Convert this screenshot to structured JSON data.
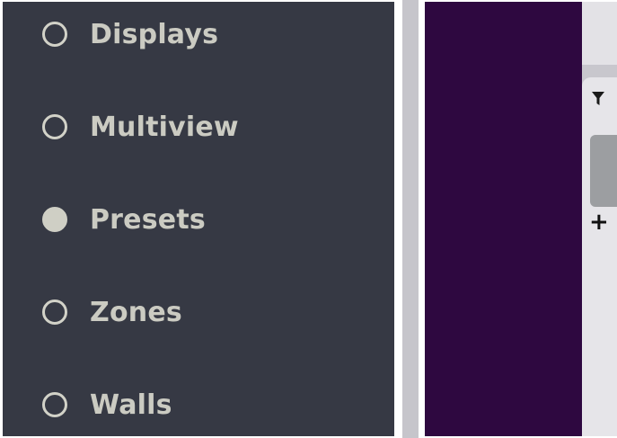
{
  "sidebar": {
    "items": [
      {
        "label": "Displays",
        "selected": false
      },
      {
        "label": "Multiview",
        "selected": false
      },
      {
        "label": "Presets",
        "selected": true
      },
      {
        "label": "Zones",
        "selected": false
      },
      {
        "label": "Walls",
        "selected": false
      }
    ]
  },
  "right_panel": {
    "add_label": "+",
    "icons": {
      "filter": "filter-icon"
    }
  },
  "colors": {
    "sidebar_bg": "#363944",
    "sidebar_text": "#cbcbc2",
    "canvas_bg": "#2e0840",
    "panel_bg": "#e6e5e9"
  }
}
